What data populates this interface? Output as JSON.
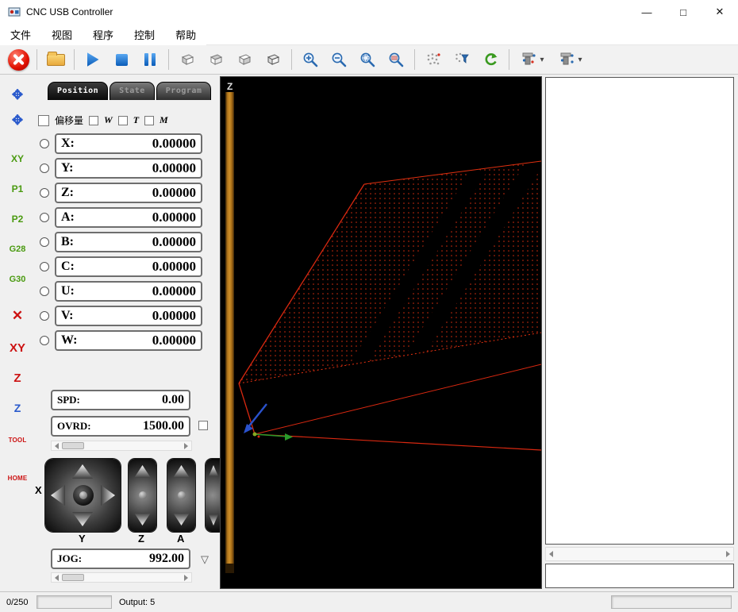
{
  "window": {
    "title": "CNC USB Controller",
    "minimize": "—",
    "maximize": "□",
    "close": "✕"
  },
  "menu": {
    "items": [
      "文件",
      "视图",
      "程序",
      "控制",
      "帮助"
    ]
  },
  "icons": {
    "dropdown": "▾",
    "spinner": "▽"
  },
  "sidebar": {
    "items": [
      {
        "label": "✥"
      },
      {
        "label": "✥"
      },
      {
        "label": "XY"
      },
      {
        "label": "P1"
      },
      {
        "label": "P2"
      },
      {
        "label": "G28"
      },
      {
        "label": "G30"
      },
      {
        "label": "✕"
      },
      {
        "label": "XY"
      },
      {
        "label": "Z"
      },
      {
        "label": "Z"
      },
      {
        "label": "TOOL"
      },
      {
        "label": "HOME"
      }
    ]
  },
  "panel": {
    "tabs": [
      {
        "label": "Position"
      },
      {
        "label": "State"
      },
      {
        "label": "Program"
      }
    ],
    "offsets": {
      "offset_label": "偏移量",
      "w": "W",
      "t": "T",
      "m": "M"
    },
    "axes": [
      {
        "name": "X:",
        "value": "0.00000"
      },
      {
        "name": "Y:",
        "value": "0.00000"
      },
      {
        "name": "Z:",
        "value": "0.00000"
      },
      {
        "name": "A:",
        "value": "0.00000"
      },
      {
        "name": "B:",
        "value": "0.00000"
      },
      {
        "name": "C:",
        "value": "0.00000"
      },
      {
        "name": "U:",
        "value": "0.00000"
      },
      {
        "name": "V:",
        "value": "0.00000"
      },
      {
        "name": "W:",
        "value": "0.00000"
      }
    ],
    "spd": {
      "label": "SPD:",
      "value": "0.00"
    },
    "ovrd": {
      "label": "OVRD:",
      "value": "1500.00"
    },
    "jog": {
      "label": "JOG:",
      "value": "992.00"
    },
    "jog_labels": {
      "x": "X",
      "y": "Y",
      "z": "Z",
      "a": "A"
    }
  },
  "viewport": {
    "z_axis_label": "Z"
  },
  "statusbar": {
    "counter": "0/250",
    "output": "Output: 5"
  }
}
